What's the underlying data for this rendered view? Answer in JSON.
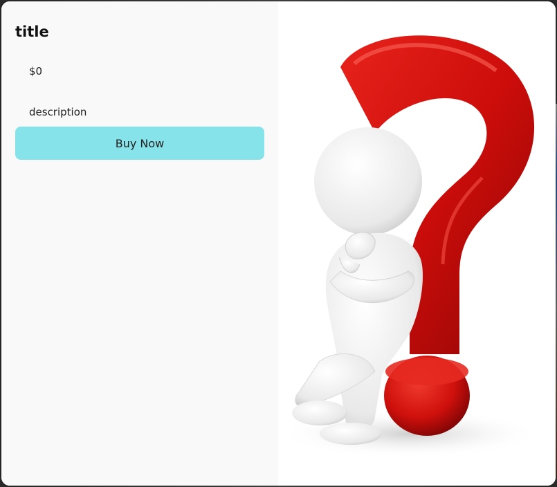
{
  "product": {
    "title": "title",
    "price": "$0",
    "description": "description",
    "buy_label": "Buy Now",
    "image_icon": "question-mark-thinker-illustration"
  },
  "colors": {
    "button_bg": "#87e3ea",
    "panel_bg": "#f9f9f9",
    "question_mark_red": "#d8120f"
  }
}
